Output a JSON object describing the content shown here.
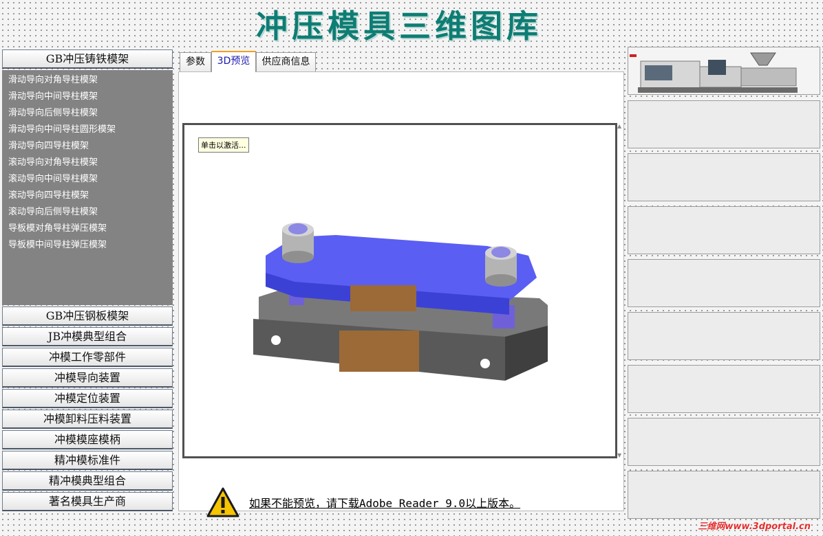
{
  "page": {
    "title": "冲压模具三维图库"
  },
  "sidebar": {
    "expanded": {
      "label": "GB冲压铸铁模架",
      "items": [
        "滑动导向对角导柱模架",
        "滑动导向中间导柱模架",
        "滑动导向后侧导柱模架",
        "滑动导向中间导柱圆形模架",
        "滑动导向四导柱模架",
        "滚动导向对角导柱模架",
        "滚动导向中间导柱模架",
        "滚动导向四导柱模架",
        "滚动导向后侧导柱模架",
        "导板模对角导柱弹压模架",
        "导板模中间导柱弹压模架"
      ]
    },
    "categories": [
      "GB冲压钢板模架",
      "JB冲模典型组合",
      "冲模工作零部件",
      "冲模导向装置",
      "冲模定位装置",
      "冲模卸料压料装置",
      "冲模模座模柄",
      "精冲模标准件",
      "精冲模典型组合",
      "著名模具生产商"
    ]
  },
  "tabs": {
    "params": "参数",
    "preview": "3D预览",
    "supplier": "供应商信息",
    "active": "3D预览"
  },
  "viewer": {
    "activate_label": "单击以激活..."
  },
  "notice": {
    "text": "如果不能预览，请下载Adobe Reader 9.0以上版本。"
  },
  "footer": {
    "watermark": "三维网www.3dportal.cn"
  },
  "colors": {
    "title": "#0e7d74",
    "sidebar_panel": "#838383",
    "top_plate": "#5b5ef2",
    "bottom_plate": "#5e5e5e",
    "block": "#9b6a37"
  }
}
